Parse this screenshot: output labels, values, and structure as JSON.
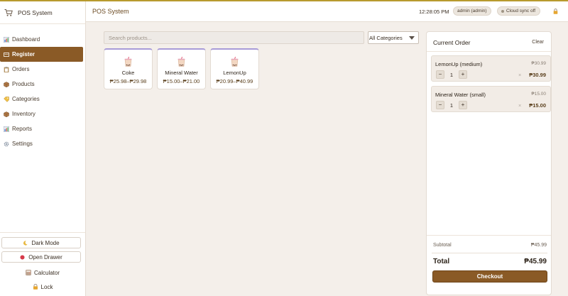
{
  "app": {
    "title": "POS System"
  },
  "header": {
    "page_title": "POS System",
    "time": "12:28:05 PM",
    "user_badge": "admin (admin)",
    "sync_badge": "Cloud sync off"
  },
  "sidebar": {
    "items": [
      {
        "label": "Dashboard",
        "icon": "chart-icon",
        "active": false
      },
      {
        "label": "Register",
        "icon": "register-icon",
        "active": true
      },
      {
        "label": "Orders",
        "icon": "clipboard-icon",
        "active": false
      },
      {
        "label": "Products",
        "icon": "box-icon",
        "active": false
      },
      {
        "label": "Categories",
        "icon": "tag-icon",
        "active": false
      },
      {
        "label": "Inventory",
        "icon": "box-icon",
        "active": false
      },
      {
        "label": "Reports",
        "icon": "chart-icon",
        "active": false
      },
      {
        "label": "Settings",
        "icon": "gear-icon",
        "active": false
      }
    ],
    "dark_mode_label": "Dark Mode",
    "open_drawer_label": "Open Drawer",
    "calculator_label": "Calculator",
    "lock_label": "Lock"
  },
  "register": {
    "search_placeholder": "Search products...",
    "category_filter": "All Categories",
    "products": [
      {
        "name": "Coke",
        "price_range": "₱25.98–₱29.98"
      },
      {
        "name": "Mineral Water",
        "price_range": "₱15.00–₱21.00"
      },
      {
        "name": "LemonUp",
        "price_range": "₱20.99–₱40.99"
      }
    ]
  },
  "order": {
    "title": "Current Order",
    "clear_label": "Clear",
    "lines": [
      {
        "name": "LemonUp (medium)",
        "unit_price": "₱30.99",
        "qty": "1",
        "line_total": "₱30.99"
      },
      {
        "name": "Mineral Water (small)",
        "unit_price": "₱15.00",
        "qty": "1",
        "line_total": "₱15.00"
      }
    ],
    "subtotal_label": "Subtotal",
    "subtotal_value": "₱45.99",
    "total_label": "Total",
    "total_value": "₱45.99",
    "checkout_label": "Checkout"
  },
  "colors": {
    "accent": "#8a5a26",
    "card_top": "#a89bd8",
    "top_line": "#b89a2e"
  }
}
